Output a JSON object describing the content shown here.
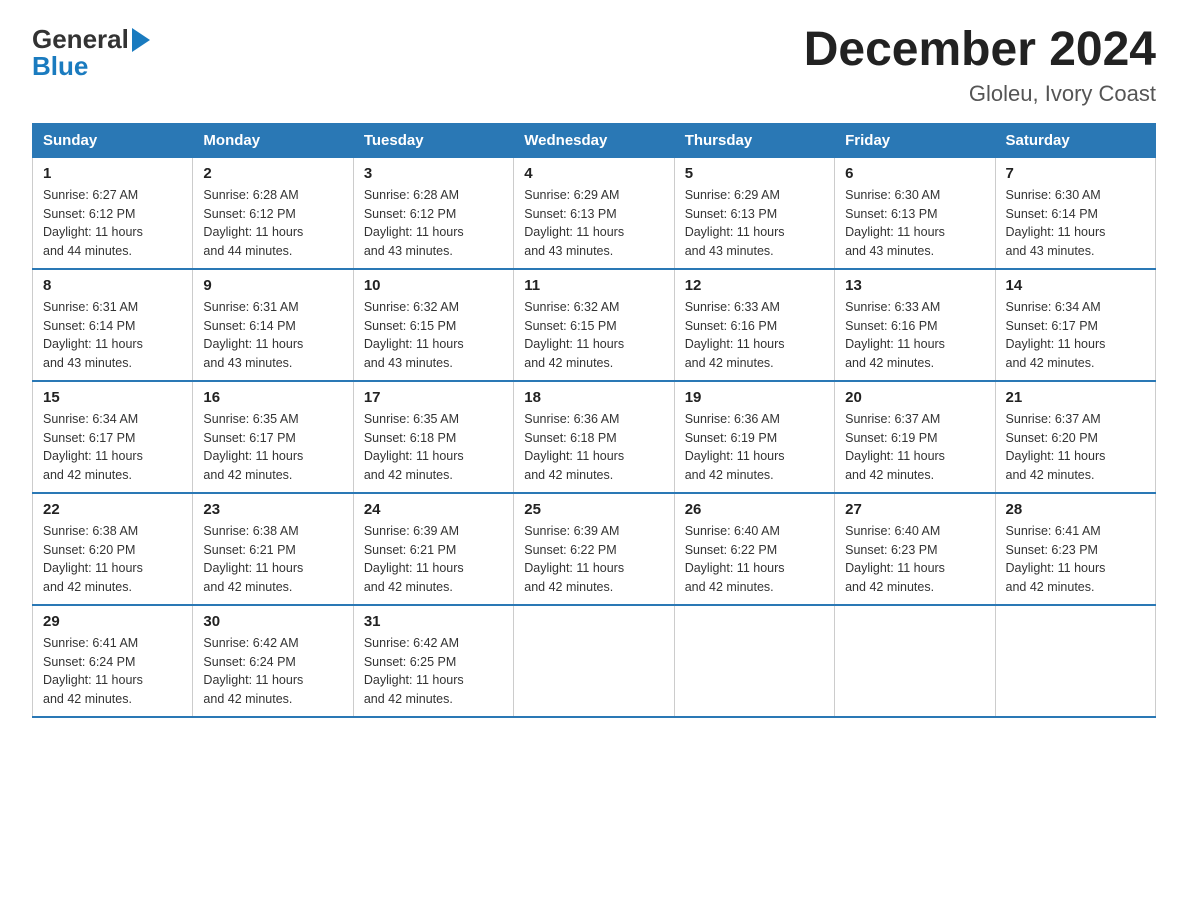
{
  "header": {
    "logo_line1": "General",
    "logo_line2": "Blue",
    "month_title": "December 2024",
    "location": "Gloleu, Ivory Coast"
  },
  "days_of_week": [
    "Sunday",
    "Monday",
    "Tuesday",
    "Wednesday",
    "Thursday",
    "Friday",
    "Saturday"
  ],
  "weeks": [
    [
      {
        "day": "1",
        "sunrise": "6:27 AM",
        "sunset": "6:12 PM",
        "daylight": "11 hours and 44 minutes."
      },
      {
        "day": "2",
        "sunrise": "6:28 AM",
        "sunset": "6:12 PM",
        "daylight": "11 hours and 44 minutes."
      },
      {
        "day": "3",
        "sunrise": "6:28 AM",
        "sunset": "6:12 PM",
        "daylight": "11 hours and 43 minutes."
      },
      {
        "day": "4",
        "sunrise": "6:29 AM",
        "sunset": "6:13 PM",
        "daylight": "11 hours and 43 minutes."
      },
      {
        "day": "5",
        "sunrise": "6:29 AM",
        "sunset": "6:13 PM",
        "daylight": "11 hours and 43 minutes."
      },
      {
        "day": "6",
        "sunrise": "6:30 AM",
        "sunset": "6:13 PM",
        "daylight": "11 hours and 43 minutes."
      },
      {
        "day": "7",
        "sunrise": "6:30 AM",
        "sunset": "6:14 PM",
        "daylight": "11 hours and 43 minutes."
      }
    ],
    [
      {
        "day": "8",
        "sunrise": "6:31 AM",
        "sunset": "6:14 PM",
        "daylight": "11 hours and 43 minutes."
      },
      {
        "day": "9",
        "sunrise": "6:31 AM",
        "sunset": "6:14 PM",
        "daylight": "11 hours and 43 minutes."
      },
      {
        "day": "10",
        "sunrise": "6:32 AM",
        "sunset": "6:15 PM",
        "daylight": "11 hours and 43 minutes."
      },
      {
        "day": "11",
        "sunrise": "6:32 AM",
        "sunset": "6:15 PM",
        "daylight": "11 hours and 42 minutes."
      },
      {
        "day": "12",
        "sunrise": "6:33 AM",
        "sunset": "6:16 PM",
        "daylight": "11 hours and 42 minutes."
      },
      {
        "day": "13",
        "sunrise": "6:33 AM",
        "sunset": "6:16 PM",
        "daylight": "11 hours and 42 minutes."
      },
      {
        "day": "14",
        "sunrise": "6:34 AM",
        "sunset": "6:17 PM",
        "daylight": "11 hours and 42 minutes."
      }
    ],
    [
      {
        "day": "15",
        "sunrise": "6:34 AM",
        "sunset": "6:17 PM",
        "daylight": "11 hours and 42 minutes."
      },
      {
        "day": "16",
        "sunrise": "6:35 AM",
        "sunset": "6:17 PM",
        "daylight": "11 hours and 42 minutes."
      },
      {
        "day": "17",
        "sunrise": "6:35 AM",
        "sunset": "6:18 PM",
        "daylight": "11 hours and 42 minutes."
      },
      {
        "day": "18",
        "sunrise": "6:36 AM",
        "sunset": "6:18 PM",
        "daylight": "11 hours and 42 minutes."
      },
      {
        "day": "19",
        "sunrise": "6:36 AM",
        "sunset": "6:19 PM",
        "daylight": "11 hours and 42 minutes."
      },
      {
        "day": "20",
        "sunrise": "6:37 AM",
        "sunset": "6:19 PM",
        "daylight": "11 hours and 42 minutes."
      },
      {
        "day": "21",
        "sunrise": "6:37 AM",
        "sunset": "6:20 PM",
        "daylight": "11 hours and 42 minutes."
      }
    ],
    [
      {
        "day": "22",
        "sunrise": "6:38 AM",
        "sunset": "6:20 PM",
        "daylight": "11 hours and 42 minutes."
      },
      {
        "day": "23",
        "sunrise": "6:38 AM",
        "sunset": "6:21 PM",
        "daylight": "11 hours and 42 minutes."
      },
      {
        "day": "24",
        "sunrise": "6:39 AM",
        "sunset": "6:21 PM",
        "daylight": "11 hours and 42 minutes."
      },
      {
        "day": "25",
        "sunrise": "6:39 AM",
        "sunset": "6:22 PM",
        "daylight": "11 hours and 42 minutes."
      },
      {
        "day": "26",
        "sunrise": "6:40 AM",
        "sunset": "6:22 PM",
        "daylight": "11 hours and 42 minutes."
      },
      {
        "day": "27",
        "sunrise": "6:40 AM",
        "sunset": "6:23 PM",
        "daylight": "11 hours and 42 minutes."
      },
      {
        "day": "28",
        "sunrise": "6:41 AM",
        "sunset": "6:23 PM",
        "daylight": "11 hours and 42 minutes."
      }
    ],
    [
      {
        "day": "29",
        "sunrise": "6:41 AM",
        "sunset": "6:24 PM",
        "daylight": "11 hours and 42 minutes."
      },
      {
        "day": "30",
        "sunrise": "6:42 AM",
        "sunset": "6:24 PM",
        "daylight": "11 hours and 42 minutes."
      },
      {
        "day": "31",
        "sunrise": "6:42 AM",
        "sunset": "6:25 PM",
        "daylight": "11 hours and 42 minutes."
      },
      null,
      null,
      null,
      null
    ]
  ],
  "labels": {
    "sunrise": "Sunrise:",
    "sunset": "Sunset:",
    "daylight": "Daylight:"
  }
}
